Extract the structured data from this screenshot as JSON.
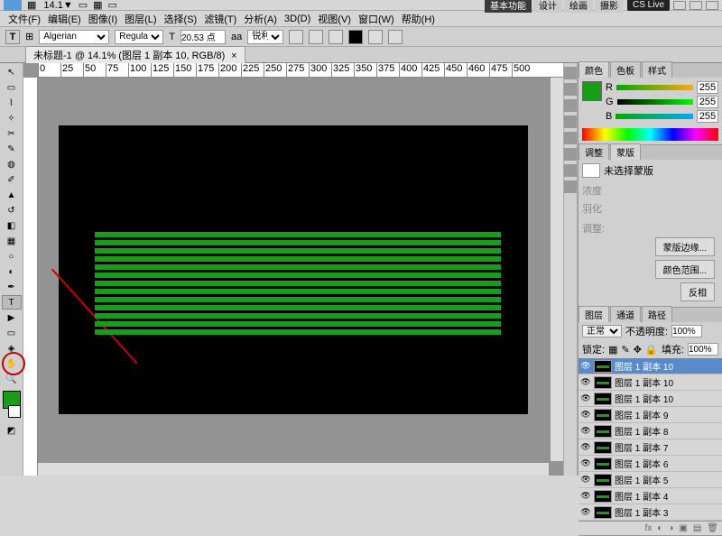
{
  "app": {
    "zoom_display": "14.1"
  },
  "workspace": {
    "tabs": [
      "基本功能",
      "设计",
      "绘画",
      "摄影"
    ],
    "active": 0,
    "cslive": "CS Live"
  },
  "menu": [
    "文件(F)",
    "编辑(E)",
    "图像(I)",
    "图层(L)",
    "选择(S)",
    "滤镜(T)",
    "分析(A)",
    "3D(D)",
    "视图(V)",
    "窗口(W)",
    "帮助(H)"
  ],
  "options_bar": {
    "tool_letter": "T",
    "font_family": "Algerian",
    "font_style": "Regular",
    "font_size": "20.53 点",
    "aa_label": "aa",
    "aa_mode": "锐利"
  },
  "doc_tab": {
    "title": "未标题-1 @ 14.1% (图层 1 副本 10, RGB/8)",
    "close": "×"
  },
  "ruler_ticks": [
    "0",
    "25",
    "50",
    "75",
    "100",
    "125",
    "150",
    "175",
    "200",
    "225",
    "250",
    "275",
    "300",
    "325",
    "350",
    "375",
    "400",
    "425",
    "450",
    "460",
    "475",
    "500"
  ],
  "canvas": {
    "stripe_count": 13
  },
  "color_panel": {
    "tabs": [
      "颜色",
      "色板",
      "样式"
    ],
    "r": {
      "label": "R",
      "value": "255"
    },
    "g": {
      "label": "G",
      "value": "255"
    },
    "b": {
      "label": "B",
      "value": "255"
    }
  },
  "adjust_panel": {
    "tabs": [
      "调整",
      "蒙版"
    ],
    "status": "未选择蒙版",
    "density_label": "浓度",
    "feather_label": "羽化",
    "refine_label": "调整:",
    "btn1": "蒙版边缘...",
    "btn2": "颜色范围...",
    "btn3": "反相"
  },
  "layers_panel": {
    "tabs": [
      "图层",
      "通道",
      "路径"
    ],
    "blend": "正常",
    "opacity_label": "不透明度:",
    "opacity": "100%",
    "lock_label": "锁定:",
    "fill_label": "填充:",
    "fill": "100%",
    "layers": [
      {
        "name": "图层 1 副本 10",
        "selected": true
      },
      {
        "name": "图层 1 副本 10",
        "selected": false
      },
      {
        "name": "图层 1 副本 10",
        "selected": false
      },
      {
        "name": "图层 1 副本 9",
        "selected": false
      },
      {
        "name": "图层 1 副本 8",
        "selected": false
      },
      {
        "name": "图层 1 副本 7",
        "selected": false
      },
      {
        "name": "图层 1 副本 6",
        "selected": false
      },
      {
        "name": "图层 1 副本 5",
        "selected": false
      },
      {
        "name": "图层 1 副本 4",
        "selected": false
      },
      {
        "name": "图层 1 副本 3",
        "selected": false
      }
    ]
  }
}
